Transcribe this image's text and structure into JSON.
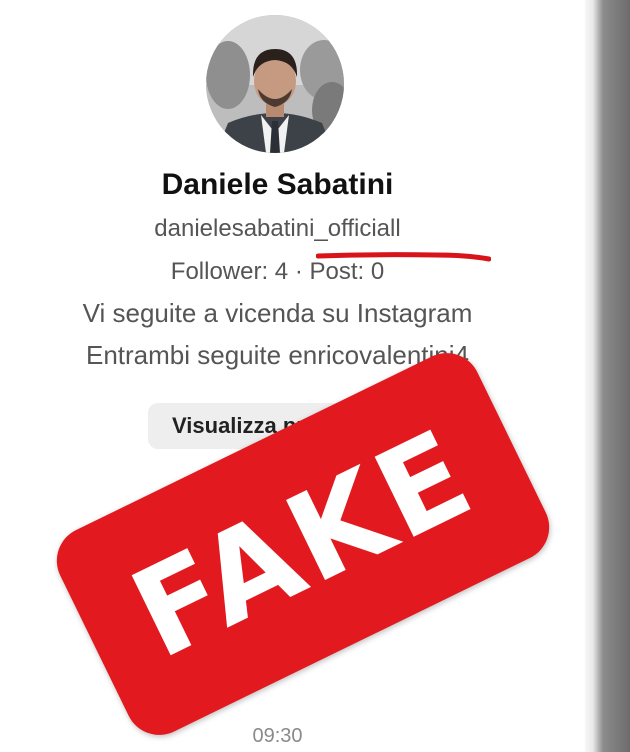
{
  "profile": {
    "name": "Daniele Sabatini",
    "username": "danielesabatini_officiall",
    "stats": "Follower: 4 · Post: 0",
    "mutual_follow": "Vi seguite a vicenda su Instagram",
    "common_following": "Entrambi seguite enricovalentini4"
  },
  "actions": {
    "view_profile_label": "Visualizza profilo"
  },
  "footer": {
    "time": "09:30"
  },
  "overlay": {
    "stamp_text": "FAKE"
  },
  "colors": {
    "stamp_red": "#e21a1f",
    "underline_red": "#d8141a",
    "text_gray": "#555555",
    "button_bg": "#eeeeee"
  },
  "icons": {
    "avatar": "profile-photo"
  }
}
